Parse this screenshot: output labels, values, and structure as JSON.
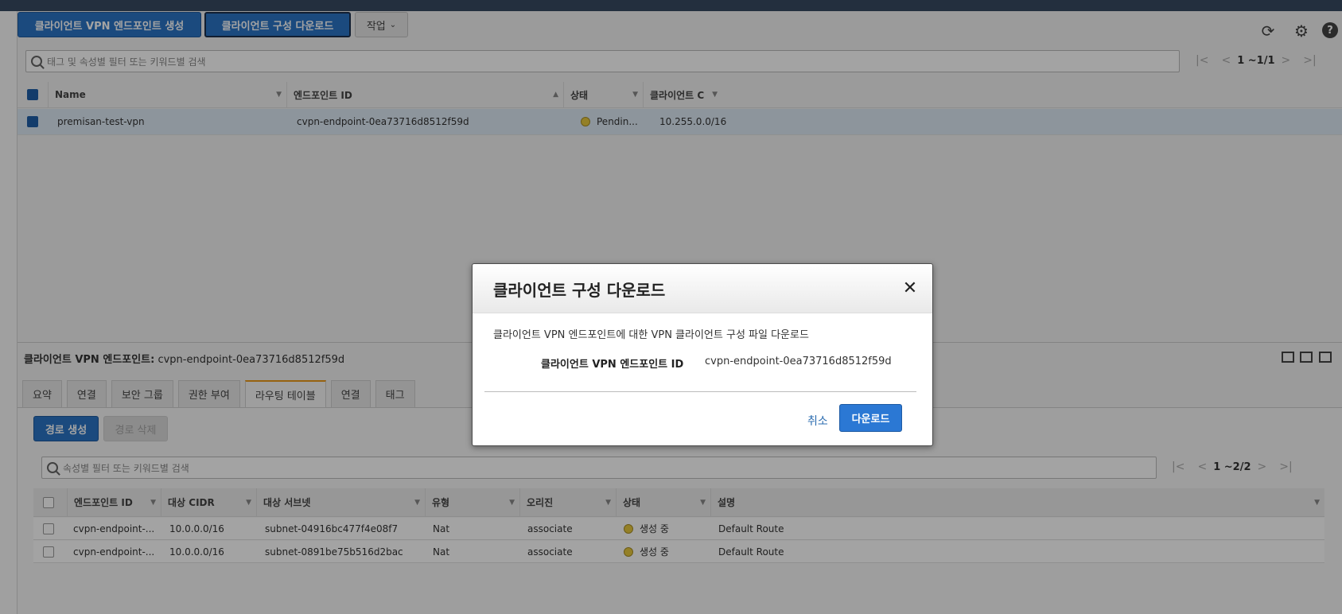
{
  "toolbar": {
    "create_endpoint_label": "클라이언트 VPN 엔드포인트 생성",
    "download_config_label": "클라이언트 구성 다운로드",
    "actions_label": "작업"
  },
  "search_top": {
    "placeholder": "태그 및 속성별 필터 또는 키워드별 검색",
    "pager": "1 ~1/1"
  },
  "endpoints_table": {
    "headers": [
      "Name",
      "엔드포인트 ID",
      "상태",
      "클라이언트 C"
    ],
    "rows": [
      {
        "name": "premisan-test-vpn",
        "endpoint_id": "cvpn-endpoint-0ea73716d8512f59d",
        "status": "Pendin...",
        "client_cidr": "10.255.0.0/16"
      }
    ]
  },
  "details": {
    "title_label": "클라이언트 VPN 엔드포인트:",
    "title_value": "cvpn-endpoint-0ea73716d8512f59d",
    "tabs": [
      "요약",
      "연결",
      "보안 그룹",
      "권한 부여",
      "라우팅 테이블",
      "연결",
      "태그"
    ],
    "active_tab": "라우팅 테이블",
    "create_route_label": "경로 생성",
    "delete_route_label": "경로 삭제"
  },
  "search_routes": {
    "placeholder": "속성별 필터 또는 키워드별 검색",
    "pager": "1 ~2/2"
  },
  "routes_table": {
    "headers": [
      "엔드포인트 ID",
      "대상 CIDR",
      "대상 서브넷",
      "유형",
      "오리진",
      "상태",
      "설명"
    ],
    "rows": [
      {
        "endpoint": "cvpn-endpoint-...",
        "cidr": "10.0.0.0/16",
        "subnet": "subnet-04916bc477f4e08f7",
        "type": "Nat",
        "origin": "associate",
        "status": "생성 중",
        "desc": "Default Route"
      },
      {
        "endpoint": "cvpn-endpoint-...",
        "cidr": "10.0.0.0/16",
        "subnet": "subnet-0891be75b516d2bac",
        "type": "Nat",
        "origin": "associate",
        "status": "생성 중",
        "desc": "Default Route"
      }
    ]
  },
  "modal": {
    "title": "클라이언트 구성 다운로드",
    "description": "클라이언트 VPN 엔드포인트에 대한 VPN 클라이언트 구성 파일 다운로드",
    "field_label": "클라이언트 VPN 엔드포인트 ID",
    "field_value": "cvpn-endpoint-0ea73716d8512f59d",
    "cancel_label": "취소",
    "download_label": "다운로드"
  },
  "icons": {
    "refresh": "refresh-icon",
    "settings": "gear-icon",
    "help": "help-icon",
    "close": "close-icon"
  },
  "colors": {
    "primary": "#2b74c5",
    "top_bar": "#232f3e",
    "active_tab": "#ec9a1a",
    "pending": "#e8c93e"
  }
}
